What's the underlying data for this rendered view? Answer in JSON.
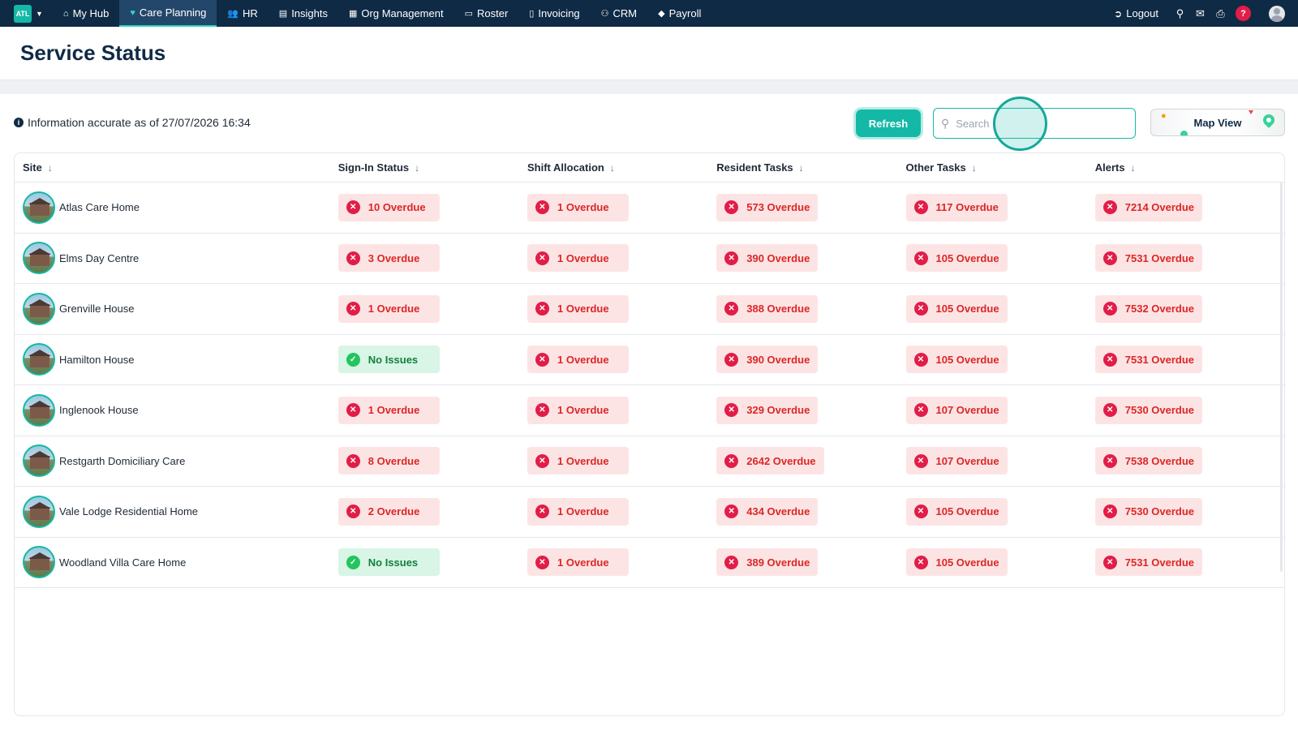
{
  "nav": {
    "brand": "ATL",
    "items": [
      {
        "label": "My Hub",
        "icon": "home-icon",
        "glyph": "⌂",
        "active": false
      },
      {
        "label": "Care Planning",
        "icon": "heart-icon",
        "glyph": "♥",
        "active": true
      },
      {
        "label": "HR",
        "icon": "people-icon",
        "glyph": "👥",
        "active": false
      },
      {
        "label": "Insights",
        "icon": "chart-icon",
        "glyph": "▤",
        "active": false
      },
      {
        "label": "Org Management",
        "icon": "building-icon",
        "glyph": "▦",
        "active": false
      },
      {
        "label": "Roster",
        "icon": "calendar-icon",
        "glyph": "▭",
        "active": false
      },
      {
        "label": "Invoicing",
        "icon": "document-icon",
        "glyph": "▯",
        "active": false
      },
      {
        "label": "CRM",
        "icon": "contacts-icon",
        "glyph": "⚇",
        "active": false
      },
      {
        "label": "Payroll",
        "icon": "tag-icon",
        "glyph": "◆",
        "active": false
      }
    ],
    "logout_label": "Logout",
    "help_label": "?"
  },
  "page": {
    "title": "Service Status",
    "info_text": "Information accurate as of 27/07/2026 16:34",
    "refresh_label": "Refresh",
    "search_placeholder": "Search",
    "map_view_label": "Map View"
  },
  "table": {
    "columns": [
      "Site",
      "Sign-In Status",
      "Shift Allocation",
      "Resident Tasks",
      "Other Tasks",
      "Alerts"
    ],
    "rows": [
      {
        "site": "Atlas Care Home",
        "cells": [
          {
            "text": "10 Overdue",
            "status": "overdue"
          },
          {
            "text": "1 Overdue",
            "status": "overdue"
          },
          {
            "text": "573 Overdue",
            "status": "overdue"
          },
          {
            "text": "117 Overdue",
            "status": "overdue"
          },
          {
            "text": "7214 Overdue",
            "status": "overdue"
          }
        ]
      },
      {
        "site": "Elms Day Centre",
        "cells": [
          {
            "text": "3 Overdue",
            "status": "overdue"
          },
          {
            "text": "1 Overdue",
            "status": "overdue"
          },
          {
            "text": "390 Overdue",
            "status": "overdue"
          },
          {
            "text": "105 Overdue",
            "status": "overdue"
          },
          {
            "text": "7531 Overdue",
            "status": "overdue"
          }
        ]
      },
      {
        "site": "Grenville House",
        "cells": [
          {
            "text": "1 Overdue",
            "status": "overdue"
          },
          {
            "text": "1 Overdue",
            "status": "overdue"
          },
          {
            "text": "388 Overdue",
            "status": "overdue"
          },
          {
            "text": "105 Overdue",
            "status": "overdue"
          },
          {
            "text": "7532 Overdue",
            "status": "overdue"
          }
        ]
      },
      {
        "site": "Hamilton House",
        "cells": [
          {
            "text": "No Issues",
            "status": "ok"
          },
          {
            "text": "1 Overdue",
            "status": "overdue"
          },
          {
            "text": "390 Overdue",
            "status": "overdue"
          },
          {
            "text": "105 Overdue",
            "status": "overdue"
          },
          {
            "text": "7531 Overdue",
            "status": "overdue"
          }
        ]
      },
      {
        "site": "Inglenook House",
        "cells": [
          {
            "text": "1 Overdue",
            "status": "overdue"
          },
          {
            "text": "1 Overdue",
            "status": "overdue"
          },
          {
            "text": "329 Overdue",
            "status": "overdue"
          },
          {
            "text": "107 Overdue",
            "status": "overdue"
          },
          {
            "text": "7530 Overdue",
            "status": "overdue"
          }
        ]
      },
      {
        "site": "Restgarth Domiciliary Care",
        "cells": [
          {
            "text": "8 Overdue",
            "status": "overdue"
          },
          {
            "text": "1 Overdue",
            "status": "overdue"
          },
          {
            "text": "2642 Overdue",
            "status": "overdue"
          },
          {
            "text": "107 Overdue",
            "status": "overdue"
          },
          {
            "text": "7538 Overdue",
            "status": "overdue"
          }
        ]
      },
      {
        "site": "Vale Lodge Residential Home",
        "cells": [
          {
            "text": "2 Overdue",
            "status": "overdue"
          },
          {
            "text": "1 Overdue",
            "status": "overdue"
          },
          {
            "text": "434 Overdue",
            "status": "overdue"
          },
          {
            "text": "105 Overdue",
            "status": "overdue"
          },
          {
            "text": "7530 Overdue",
            "status": "overdue"
          }
        ]
      },
      {
        "site": "Woodland Villa Care Home",
        "cells": [
          {
            "text": "No Issues",
            "status": "ok"
          },
          {
            "text": "1 Overdue",
            "status": "overdue"
          },
          {
            "text": "389 Overdue",
            "status": "overdue"
          },
          {
            "text": "105 Overdue",
            "status": "overdue"
          },
          {
            "text": "7531 Overdue",
            "status": "overdue"
          }
        ]
      }
    ]
  },
  "colors": {
    "nav_bg": "#0f2a45",
    "accent": "#14b8a6",
    "overdue_bg": "#fde4e4",
    "overdue_text": "#dc2626",
    "ok_bg": "#d8f5e6",
    "ok_text": "#15803d"
  }
}
